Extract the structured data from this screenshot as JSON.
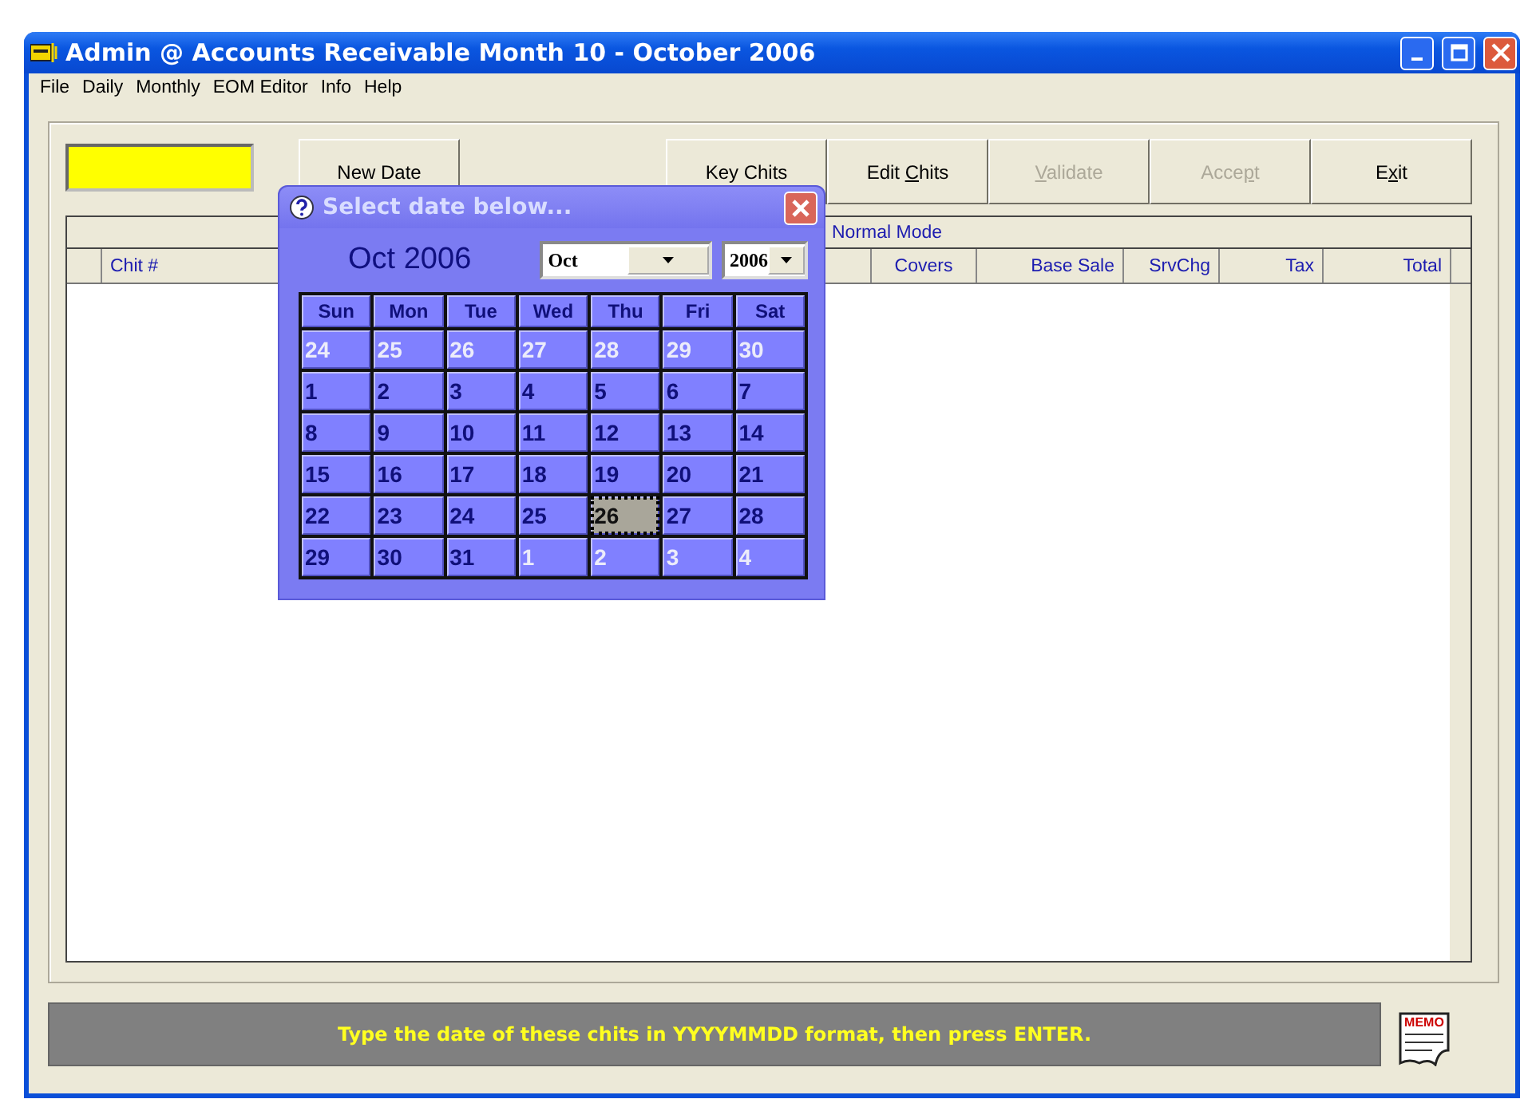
{
  "window": {
    "title": "Admin @ Accounts Receivable Month 10 - October 2006"
  },
  "menu": [
    "File",
    "Daily",
    "Monthly",
    "EOM Editor",
    "Info",
    "Help"
  ],
  "left_buttons": [
    {
      "label": "New Date",
      "disabled": false
    }
  ],
  "right_buttons": [
    {
      "label": "Key Chits",
      "disabled": false
    },
    {
      "pre": "Edit ",
      "key": "C",
      "post": "hits",
      "disabled": false
    },
    {
      "key": "V",
      "post": "alidate",
      "disabled": true
    },
    {
      "pre": "Acce",
      "key": "p",
      "post": "t",
      "disabled": true
    },
    {
      "pre": "E",
      "key": "x",
      "post": "it",
      "disabled": false
    }
  ],
  "grid": {
    "mode": "Normal Mode",
    "first_column": "Chit #",
    "columns": [
      "Covers",
      "Base Sale",
      "SrvChg",
      "Tax",
      "Total"
    ]
  },
  "date_popup": {
    "title": "Select date below...",
    "heading": "Oct 2006",
    "month": "Oct",
    "year": "2006",
    "weekdays": [
      "Sun",
      "Mon",
      "Tue",
      "Wed",
      "Thu",
      "Fri",
      "Sat"
    ],
    "days": [
      {
        "label": "24",
        "muted": true,
        "selected": false
      },
      {
        "label": "25",
        "muted": true,
        "selected": false
      },
      {
        "label": "26",
        "muted": true,
        "selected": false
      },
      {
        "label": "27",
        "muted": true,
        "selected": false
      },
      {
        "label": "28",
        "muted": true,
        "selected": false
      },
      {
        "label": "29",
        "muted": true,
        "selected": false
      },
      {
        "label": "30",
        "muted": true,
        "selected": false
      },
      {
        "label": "1",
        "muted": false,
        "selected": false
      },
      {
        "label": "2",
        "muted": false,
        "selected": false
      },
      {
        "label": "3",
        "muted": false,
        "selected": false
      },
      {
        "label": "4",
        "muted": false,
        "selected": false
      },
      {
        "label": "5",
        "muted": false,
        "selected": false
      },
      {
        "label": "6",
        "muted": false,
        "selected": false
      },
      {
        "label": "7",
        "muted": false,
        "selected": false
      },
      {
        "label": "8",
        "muted": false,
        "selected": false
      },
      {
        "label": "9",
        "muted": false,
        "selected": false
      },
      {
        "label": "10",
        "muted": false,
        "selected": false
      },
      {
        "label": "11",
        "muted": false,
        "selected": false
      },
      {
        "label": "12",
        "muted": false,
        "selected": false
      },
      {
        "label": "13",
        "muted": false,
        "selected": false
      },
      {
        "label": "14",
        "muted": false,
        "selected": false
      },
      {
        "label": "15",
        "muted": false,
        "selected": false
      },
      {
        "label": "16",
        "muted": false,
        "selected": false
      },
      {
        "label": "17",
        "muted": false,
        "selected": false
      },
      {
        "label": "18",
        "muted": false,
        "selected": false
      },
      {
        "label": "19",
        "muted": false,
        "selected": false
      },
      {
        "label": "20",
        "muted": false,
        "selected": false
      },
      {
        "label": "21",
        "muted": false,
        "selected": false
      },
      {
        "label": "22",
        "muted": false,
        "selected": false
      },
      {
        "label": "23",
        "muted": false,
        "selected": false
      },
      {
        "label": "24",
        "muted": false,
        "selected": false
      },
      {
        "label": "25",
        "muted": false,
        "selected": false
      },
      {
        "label": "26",
        "muted": false,
        "selected": true
      },
      {
        "label": "27",
        "muted": false,
        "selected": false
      },
      {
        "label": "28",
        "muted": false,
        "selected": false
      },
      {
        "label": "29",
        "muted": false,
        "selected": false
      },
      {
        "label": "30",
        "muted": false,
        "selected": false
      },
      {
        "label": "31",
        "muted": false,
        "selected": false
      },
      {
        "label": "1",
        "muted": true,
        "selected": false
      },
      {
        "label": "2",
        "muted": true,
        "selected": false
      },
      {
        "label": "3",
        "muted": true,
        "selected": false
      },
      {
        "label": "4",
        "muted": true,
        "selected": false
      }
    ]
  },
  "status": "Type the date of these chits in YYYYMMDD format, then press ENTER.",
  "memo_icon": {
    "label": "MEMO"
  }
}
